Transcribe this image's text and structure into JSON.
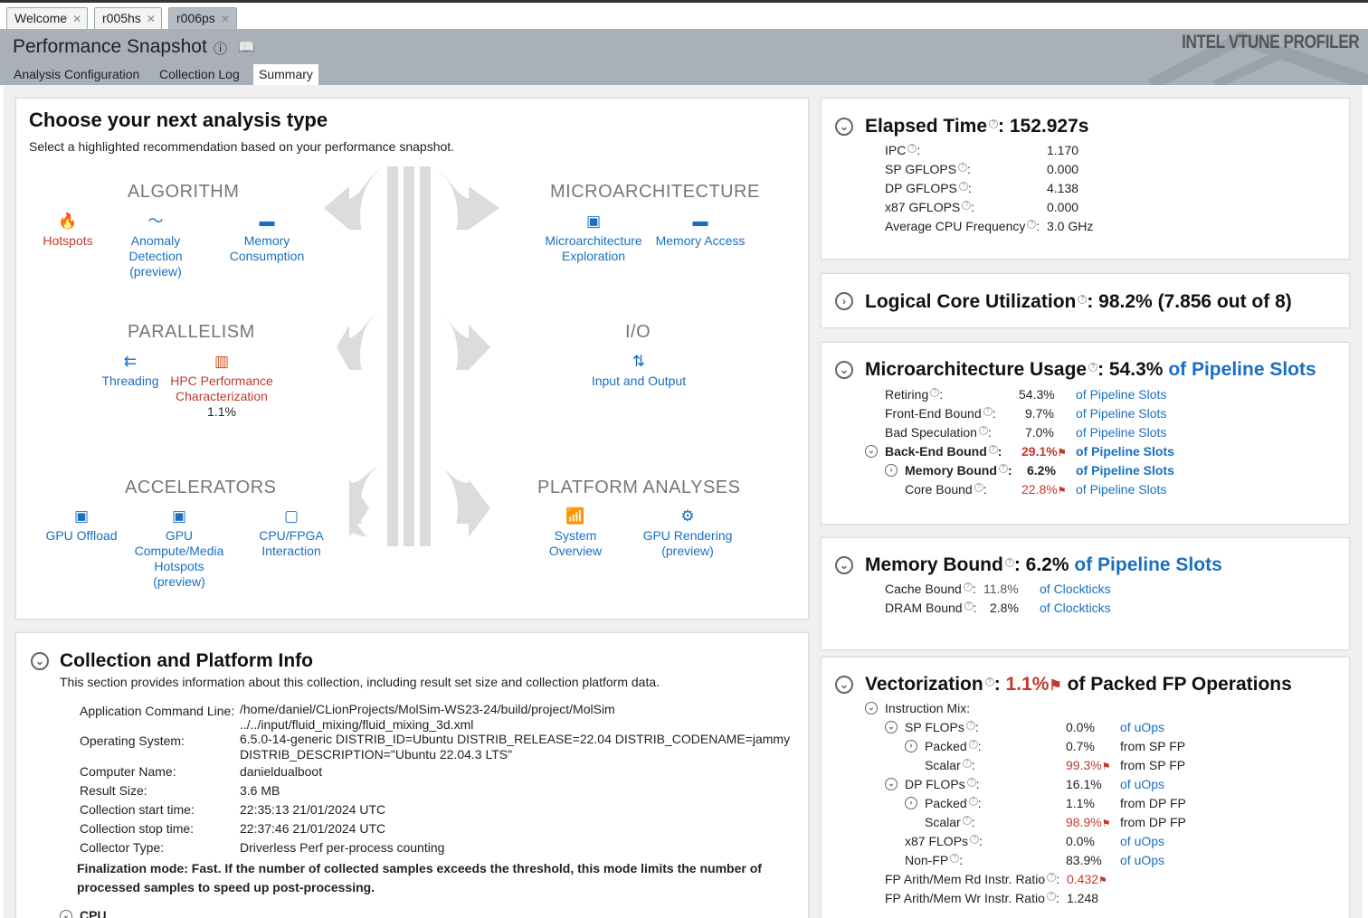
{
  "tabs": [
    {
      "label": "Welcome"
    },
    {
      "label": "r005hs"
    },
    {
      "label": "r006ps"
    }
  ],
  "header": {
    "title": "Performance Snapshot",
    "brand": "INTEL VTUNE PROFILER",
    "subtabs": [
      {
        "label": "Analysis Configuration"
      },
      {
        "label": "Collection Log"
      },
      {
        "label": "Summary"
      }
    ]
  },
  "choose": {
    "title": "Choose your next analysis type",
    "subtitle": "Select a highlighted recommendation based on your performance snapshot.",
    "categories": {
      "algorithm": "ALGORITHM",
      "microarchitecture": "MICROARCHITECTURE",
      "parallelism": "PARALLELISM",
      "io": "I/O",
      "accelerators": "ACCELERATORS",
      "platform": "PLATFORM ANALYSES"
    },
    "items": {
      "hotspots": "Hotspots",
      "anomaly": "Anomaly Detection (preview)",
      "memory_consumption": "Memory Consumption",
      "uarch_exploration": "Microarchitecture Exploration",
      "memory_access": "Memory Access",
      "threading": "Threading",
      "hpc": "HPC Performance Characterization",
      "hpc_value": "1.1%",
      "io": "Input and Output",
      "gpu_offload": "GPU Offload",
      "gpu_compute": "GPU Compute/Media Hotspots (preview)",
      "cpu_fpga": "CPU/FPGA Interaction",
      "system_overview": "System Overview",
      "gpu_rendering": "GPU Rendering (preview)"
    }
  },
  "collection": {
    "title": "Collection and Platform Info",
    "subtitle": "This section provides information about this collection, including result set size and collection platform data.",
    "rows": [
      {
        "k": "Application Command Line:",
        "v": "/home/daniel/CLionProjects/MolSim-WS23-24/build/project/MolSim",
        "v2": "../../input/fluid_mixing/fluid_mixing_3d.xml"
      },
      {
        "k": "Operating System:",
        "v": "6.5.0-14-generic DISTRIB_ID=Ubuntu DISTRIB_RELEASE=22.04 DISTRIB_CODENAME=jammy",
        "v2": "DISTRIB_DESCRIPTION=\"Ubuntu 22.04.3 LTS\""
      },
      {
        "k": "Computer Name:",
        "v": "danieldualboot"
      },
      {
        "k": "Result Size:",
        "v": "3.6 MB"
      },
      {
        "k": "Collection start time:",
        "v": "22:35:13 21/01/2024 UTC"
      },
      {
        "k": "Collection stop time:",
        "v": "22:37:46 21/01/2024 UTC"
      },
      {
        "k": "Collector Type:",
        "v": "Driverless Perf per-process counting"
      }
    ],
    "note": "Finalization mode: Fast. If the number of collected samples exceeds the threshold, this mode limits the number of processed samples to speed up post-processing.",
    "cpu_label": "CPU"
  },
  "elapsed": {
    "label": "Elapsed Time",
    "value": ": 152.927s",
    "rows": [
      {
        "k": "IPC",
        "v": "1.170"
      },
      {
        "k": "SP GFLOPS",
        "v": "0.000"
      },
      {
        "k": "DP GFLOPS",
        "v": "4.138"
      },
      {
        "k": "x87 GFLOPS",
        "v": "0.000"
      },
      {
        "k": "Average CPU Frequency",
        "v": "3.0 GHz"
      }
    ]
  },
  "logical": {
    "label": "Logical Core Utilization",
    "value": ": 98.2% (7.856 out of 8)"
  },
  "uarch": {
    "label": "Microarchitecture Usage",
    "value": ": 54.3%",
    "unit": "of Pipeline Slots",
    "rows": [
      {
        "k": "Retiring",
        "v": "54.3%",
        "u": "of Pipeline Slots"
      },
      {
        "k": "Front-End Bound",
        "v": "9.7%",
        "u": "of Pipeline Slots"
      },
      {
        "k": "Bad Speculation",
        "v": "7.0%",
        "u": "of Pipeline Slots"
      },
      {
        "k": "Back-End Bound",
        "v": "29.1%",
        "u": "of Pipeline Slots"
      },
      {
        "k": "Memory Bound",
        "v": "6.2%",
        "u": "of Pipeline Slots"
      },
      {
        "k": "Core Bound",
        "v": "22.8%",
        "u": "of Pipeline Slots"
      }
    ]
  },
  "membound": {
    "label": "Memory Bound",
    "value": ": 6.2%",
    "unit": "of Pipeline Slots",
    "rows": [
      {
        "k": "Cache Bound",
        "v": "11.8%",
        "u": "of Clockticks"
      },
      {
        "k": "DRAM Bound",
        "v": "2.8%",
        "u": "of Clockticks"
      }
    ]
  },
  "vector": {
    "label": "Vectorization",
    "value": "1.1%",
    "unit": "of Packed FP Operations",
    "rows": [
      {
        "k": "Instruction Mix:",
        "v": "",
        "u": ""
      },
      {
        "k": "SP FLOPs",
        "v": "0.0%",
        "u": "of uOps"
      },
      {
        "k": "Packed",
        "v": "0.7%",
        "u": "from SP FP"
      },
      {
        "k": "Scalar",
        "v": "99.3%",
        "u": "from SP FP"
      },
      {
        "k": "DP FLOPs",
        "v": "16.1%",
        "u": "of uOps"
      },
      {
        "k": "Packed",
        "v": "1.1%",
        "u": "from DP FP"
      },
      {
        "k": "Scalar",
        "v": "98.9%",
        "u": "from DP FP"
      },
      {
        "k": "x87 FLOPs",
        "v": "0.0%",
        "u": "of uOps"
      },
      {
        "k": "Non-FP",
        "v": "83.9%",
        "u": "of uOps"
      },
      {
        "k": "FP Arith/Mem Rd Instr. Ratio",
        "v": "0.432",
        "u": ""
      },
      {
        "k": "FP Arith/Mem Wr Instr. Ratio",
        "v": "1.248",
        "u": ""
      }
    ]
  },
  "colors": {
    "link": "#1a6fc1",
    "warn": "#c0392b",
    "header": "#a9b0b8"
  }
}
